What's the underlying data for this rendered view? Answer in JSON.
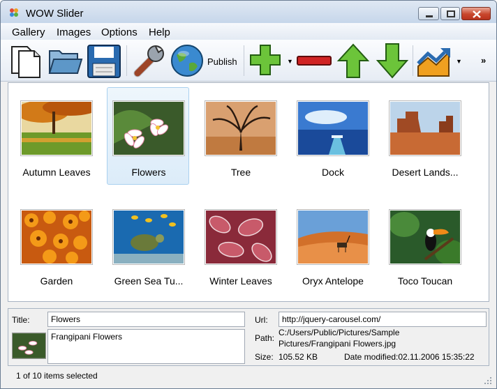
{
  "window": {
    "title": "WOW Slider"
  },
  "menu": [
    "Gallery",
    "Images",
    "Options",
    "Help"
  ],
  "toolbar": {
    "publish_label": "Publish",
    "overflow": "»"
  },
  "gallery": [
    {
      "label": "Autumn Leaves",
      "selected": false
    },
    {
      "label": "Flowers",
      "selected": true
    },
    {
      "label": "Tree",
      "selected": false
    },
    {
      "label": "Dock",
      "selected": false
    },
    {
      "label": "Desert Lands...",
      "selected": false
    },
    {
      "label": "Garden",
      "selected": false
    },
    {
      "label": "Green Sea Tu...",
      "selected": false
    },
    {
      "label": "Winter Leaves",
      "selected": false
    },
    {
      "label": "Oryx Antelope",
      "selected": false
    },
    {
      "label": "Toco Toucan",
      "selected": false
    }
  ],
  "details": {
    "title_label": "Title:",
    "title_value": "Flowers",
    "description": "Frangipani Flowers",
    "url_label": "Url:",
    "url_value": "http://jquery-carousel.com/",
    "path_label": "Path:",
    "path_value": "C:/Users/Public/Pictures/Sample Pictures/Frangipani Flowers.jpg",
    "size_label": "Size:",
    "size_value": "105.52 KB",
    "date_text": "Date modified:02.11.2006 15:35:22"
  },
  "status": {
    "text": "1 of 10 items selected"
  },
  "colors": {
    "selection": "#dcecf9",
    "selection_border": "#a9d0ef",
    "close_button": "#c8462c"
  }
}
